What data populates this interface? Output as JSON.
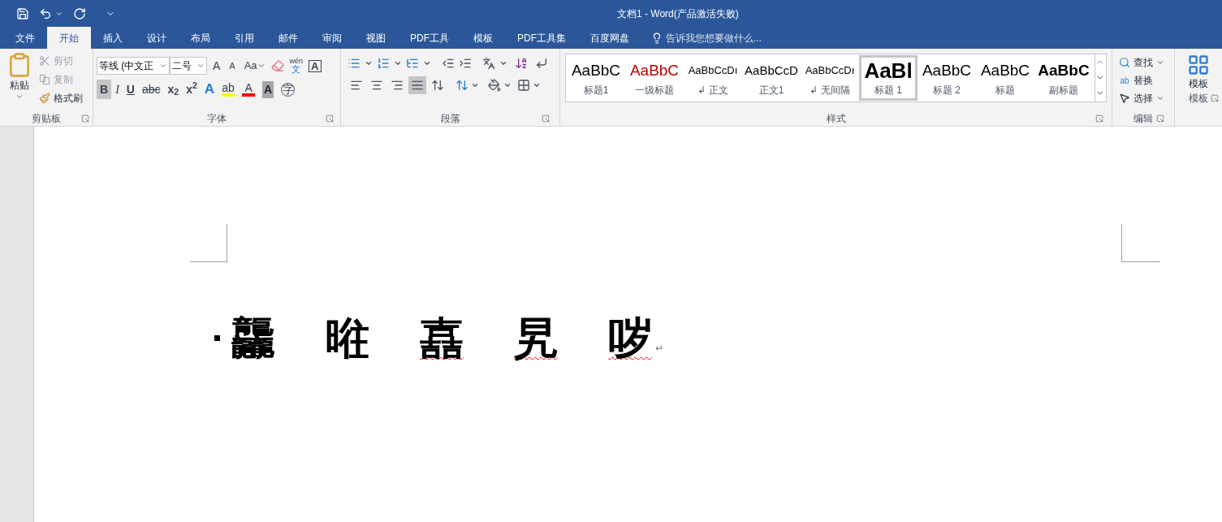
{
  "window": {
    "title": "文档1 - Word(产品激活失败)"
  },
  "tabs": [
    {
      "label": "文件",
      "selected": false
    },
    {
      "label": "开始",
      "selected": true
    },
    {
      "label": "插入",
      "selected": false
    },
    {
      "label": "设计",
      "selected": false
    },
    {
      "label": "布局",
      "selected": false
    },
    {
      "label": "引用",
      "selected": false
    },
    {
      "label": "邮件",
      "selected": false
    },
    {
      "label": "审阅",
      "selected": false
    },
    {
      "label": "视图",
      "selected": false
    },
    {
      "label": "PDF工具",
      "selected": false
    },
    {
      "label": "模板",
      "selected": false
    },
    {
      "label": "PDF工具集",
      "selected": false
    },
    {
      "label": "百度网盘",
      "selected": false
    }
  ],
  "tell_me": {
    "placeholder": "告诉我您想要做什么..."
  },
  "clipboard": {
    "paste": "粘贴",
    "cut": "剪切",
    "copy": "复制",
    "format_painter": "格式刷",
    "cut_disabled": true,
    "copy_disabled": true,
    "group_label": "剪贴板"
  },
  "font": {
    "font_name": "等线 (中文正",
    "font_size": "二号",
    "case_button": "Aa",
    "grow": "A",
    "shrink": "A",
    "phonetic_top": "wén",
    "phonetic_bottom": "文",
    "border_char": "A",
    "formatting": [
      {
        "kind": "bold",
        "label": "B",
        "selected": true
      },
      {
        "kind": "italic",
        "label": "I",
        "selected": false
      },
      {
        "kind": "underline",
        "label": "U",
        "selected": false
      },
      {
        "kind": "strike",
        "label": "abc",
        "selected": false
      },
      {
        "kind": "plain",
        "label": "x$_{2}$",
        "selected": false
      },
      {
        "kind": "plain",
        "label": "x$^{2}$",
        "selected": false
      },
      {
        "kind": "effects",
        "label": "A",
        "selected": false
      },
      {
        "kind": "highlight",
        "label": "ab",
        "color": "#ffff00",
        "selected": false
      },
      {
        "kind": "fontcolor",
        "label": "A",
        "color": "#ff0000",
        "selected": false
      },
      {
        "kind": "shaded",
        "label": "A",
        "selected": false
      },
      {
        "kind": "circled",
        "label": "字",
        "selected": false
      }
    ],
    "group_label": "字体"
  },
  "paragraph": {
    "alignments": [
      {
        "kind": "left",
        "selected": false
      },
      {
        "kind": "center",
        "selected": false
      },
      {
        "kind": "right",
        "selected": false
      },
      {
        "kind": "justify",
        "selected": true
      },
      {
        "kind": "distributed",
        "selected": false
      }
    ],
    "group_label": "段落"
  },
  "styles": {
    "items": [
      {
        "preview": "AaBbC",
        "label": "标题1",
        "kind": "large",
        "color": "#000000",
        "selected": false
      },
      {
        "preview": "AaBbC",
        "label": "一级标题",
        "kind": "large",
        "color": "#c00000",
        "selected": false
      },
      {
        "preview": "AaBbCcDı",
        "label": "↲ 正文",
        "kind": "small",
        "color": "#000000",
        "selected": false
      },
      {
        "preview": "AaBbCcD",
        "label": "正文1",
        "kind": "normal",
        "color": "#000000",
        "selected": false
      },
      {
        "preview": "AaBbCcDı",
        "label": "↲ 无间隔",
        "kind": "small",
        "color": "#000000",
        "selected": false
      },
      {
        "preview": "AaBl",
        "label": "标题 1",
        "kind": "heading",
        "color": "#000000",
        "selected": true
      },
      {
        "preview": "AaBbC",
        "label": "标题 2",
        "kind": "large",
        "color": "#000000",
        "selected": false
      },
      {
        "preview": "AaBbC",
        "label": "标题",
        "kind": "large",
        "color": "#000000",
        "selected": false
      },
      {
        "preview": "AaBbC",
        "label": "副标题",
        "kind": "bold",
        "color": "#000000",
        "selected": false
      }
    ],
    "group_label": "样式"
  },
  "editing": {
    "find": "查找",
    "replace": "替换",
    "replace_glyph": "ab",
    "select": "选择",
    "group_label": "编辑"
  },
  "template": {
    "button": "模板",
    "group_label": "模板"
  },
  "document": {
    "bullet": true,
    "para_mark": "↵",
    "chars": [
      {
        "text": "龘",
        "misspelled": false
      },
      {
        "text": "暀",
        "misspelled": false
      },
      {
        "text": "嚞",
        "misspelled": true
      },
      {
        "text": "旯",
        "misspelled": true
      },
      {
        "text": "哕",
        "misspelled": true
      }
    ]
  }
}
